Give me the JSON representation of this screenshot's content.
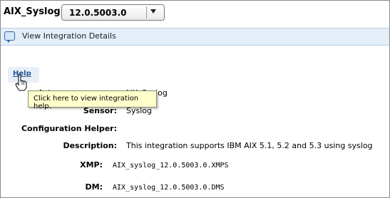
{
  "title": "AIX_Syslog",
  "version_select": {
    "value": "12.0.5003.0"
  },
  "header": {
    "label": "View Integration Details"
  },
  "help": {
    "label": "Help",
    "tooltip": "Click here to view integration help."
  },
  "details": {
    "obscured_label": "Integ",
    "obscured_value": "AIX_Syslog",
    "sensor_label": "Sensor:",
    "sensor_value": "Syslog",
    "config_label": "Configuration Helper:",
    "description_label": "Description:",
    "description_value": "This integration supports IBM AIX 5.1, 5.2 and 5.3 using syslog",
    "xmp_label": "XMP:",
    "xmp_value": "AIX_syslog_12.0.5003.0.XMPS",
    "dm_label": "DM:",
    "dm_value": "AIX_syslog_12.0.5003.0.DMS"
  }
}
